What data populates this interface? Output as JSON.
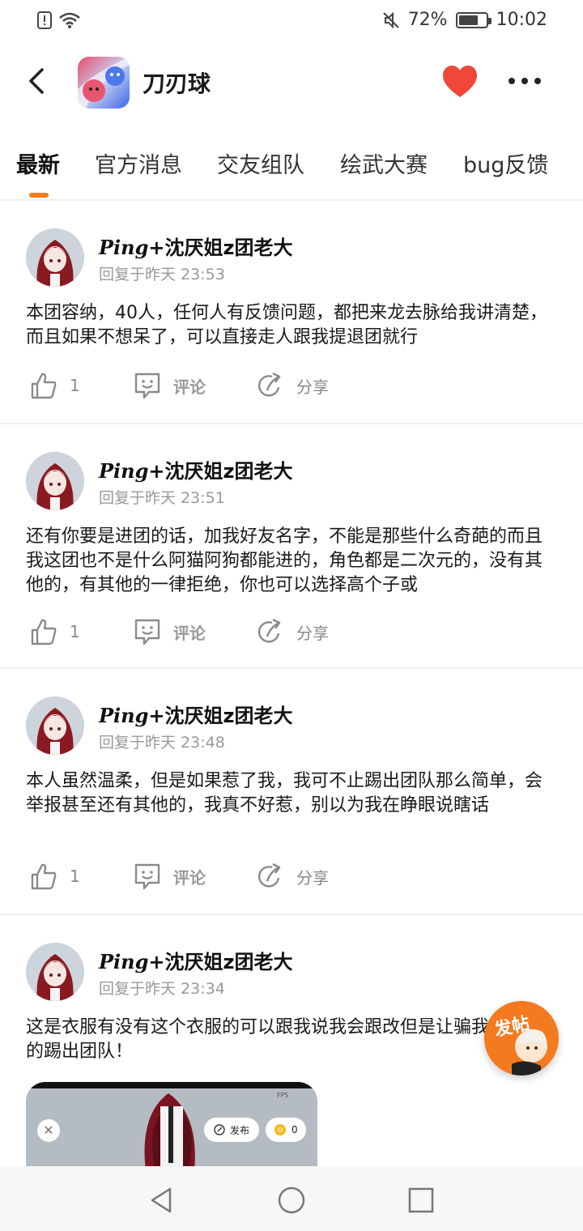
{
  "status_bar": {
    "battery_percent": "72%",
    "battery_level": 0.72,
    "time": "10:02",
    "icons": [
      "alert-icon",
      "wifi-icon",
      "mute-icon",
      "battery-icon"
    ]
  },
  "header": {
    "title": "刀刃球",
    "icons": [
      "back-icon",
      "app-icon",
      "heart-icon",
      "more-icon"
    ]
  },
  "tabs": [
    {
      "label": "最新",
      "active": true
    },
    {
      "label": "官方消息",
      "active": false
    },
    {
      "label": "交友组队",
      "active": false
    },
    {
      "label": "绘武大赛",
      "active": false
    },
    {
      "label": "bug反馈",
      "active": false
    }
  ],
  "accent_color": "#f47a1f",
  "posts": [
    {
      "author_fancy": "Ping",
      "author_rest": "+沈厌姐z团老大",
      "time": "回复于昨天 23:53",
      "content": "本团容纳，40人，任何人有反馈问题，都把来龙去脉给我讲清楚，而且如果不想呆了，可以直接走人跟我提退团就行",
      "likes": "1",
      "comment_label": "评论",
      "share_label": "分享"
    },
    {
      "author_fancy": "Ping",
      "author_rest": "+沈厌姐z团老大",
      "time": "回复于昨天 23:51",
      "content": "还有你要是进团的话，加我好友名字，不能是那些什么奇葩的而且我这团也不是什么阿猫阿狗都能进的，角色都是二次元的，没有其他的，有其他的一律拒绝，你也可以选择高个子或",
      "likes": "1",
      "comment_label": "评论",
      "share_label": "分享"
    },
    {
      "author_fancy": "Ping",
      "author_rest": "+沈厌姐z团老大",
      "time": "回复于昨天 23:48",
      "content": "本人虽然温柔，但是如果惹了我，我可不止踢出团队那么简单，会举报甚至还有其他的，我真不好惹，别以为我在睁眼说瞎话",
      "likes": "1",
      "comment_label": "评论",
      "share_label": "分享"
    },
    {
      "author_fancy": "Ping",
      "author_rest": "+沈厌姐z团老大",
      "time": "回复于昨天 23:34",
      "content": "这是衣服有没有这个衣服的可以跟我说我会跟改但是让骗我的踢出团队！"
    }
  ],
  "post_image": {
    "fps_label": "FPS",
    "publish_label": "发布",
    "coin_count": "0"
  },
  "fab": {
    "label": "发帖"
  },
  "nav_icons": [
    "nav-back-icon",
    "nav-home-icon",
    "nav-recents-icon"
  ]
}
